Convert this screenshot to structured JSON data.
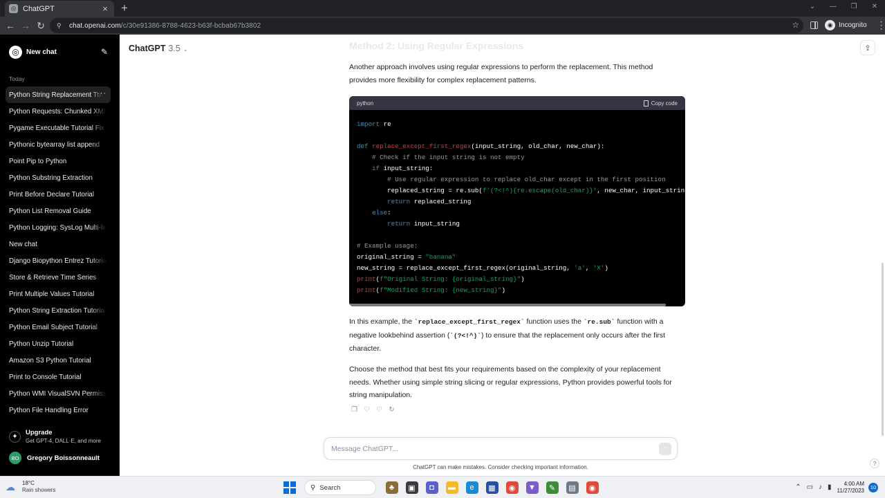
{
  "browser": {
    "tab_title": "ChatGPT",
    "tab_favicon": "chatgpt-logo-icon",
    "new_tab": "+",
    "url_host": "chat.openai.com",
    "url_path": "/c/30e91386-8788-4623-b63f-bcbab67b3802",
    "incognito_label": "Incognito"
  },
  "sidebar": {
    "new_chat_label": "New chat",
    "section_label": "Today",
    "items": [
      {
        "label": "Python String Replacement Tutorial",
        "active": true
      },
      {
        "label": "Python Requests: Chunked XML"
      },
      {
        "label": "Pygame Executable Tutorial Fix"
      },
      {
        "label": "Pythonic bytearray list append"
      },
      {
        "label": "Point Pip to Python"
      },
      {
        "label": "Python Substring Extraction"
      },
      {
        "label": "Print Before Declare Tutorial"
      },
      {
        "label": "Python List Removal Guide"
      },
      {
        "label": "Python Logging: SysLog Multi-line"
      },
      {
        "label": "New chat"
      },
      {
        "label": "Django Biopython Entrez Tutorial"
      },
      {
        "label": "Store & Retrieve Time Series"
      },
      {
        "label": "Print Multiple Values Tutorial"
      },
      {
        "label": "Python String Extraction Tutorial"
      },
      {
        "label": "Python Email Subject Tutorial"
      },
      {
        "label": "Python Unzip Tutorial"
      },
      {
        "label": "Amazon S3 Python Tutorial"
      },
      {
        "label": "Print to Console Tutorial"
      },
      {
        "label": "Python WMI VisualSVN Permissions"
      },
      {
        "label": "Python File Handling Error"
      }
    ],
    "more_label": "···",
    "upgrade_title": "Upgrade",
    "upgrade_sub": "Get GPT-4, DALL·E, and more",
    "user_initials": "BO",
    "user_name": "Gregory Boissonneault"
  },
  "header": {
    "model_name": "ChatGPT",
    "model_version": "3.5"
  },
  "content": {
    "faded_heading": "Method 2: Using Regular Expressions",
    "intro": "Another approach involves using regular expressions to perform the replacement. This method provides more flexibility for complex replacement patterns.",
    "code_lang": "python",
    "copy_label": "Copy code",
    "explain_1": "In this example, the ",
    "explain_code_1": "`replace_except_first_regex`",
    "explain_2": " function uses the ",
    "explain_code_2": "`re.sub`",
    "explain_3": " function with a negative lookbehind assertion (",
    "explain_code_3": "`(?<!^)`",
    "explain_4": ") to ensure that the replacement only occurs after the first character.",
    "closing": "Choose the method that best fits your requirements based on the complexity of your replacement needs. Whether using simple string slicing or regular expressions, Python provides powerful tools for string manipulation."
  },
  "composer": {
    "placeholder": "Message ChatGPT...",
    "disclaimer": "ChatGPT can make mistakes. Consider checking important information."
  },
  "taskbar": {
    "temp": "18°C",
    "weather": "Rain showers",
    "search_label": "Search",
    "time": "4:00 AM",
    "date": "11/27/2023",
    "notifications": "10"
  }
}
